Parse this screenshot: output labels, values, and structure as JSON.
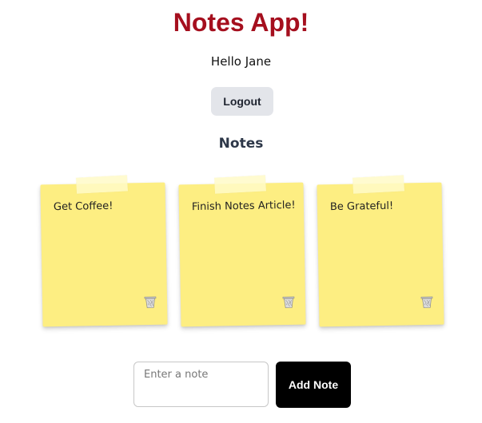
{
  "header": {
    "title": "Notes App!",
    "greeting": "Hello Jane",
    "logout_label": "Logout"
  },
  "notes_section": {
    "heading": "Notes",
    "notes": [
      {
        "text": "Get Coffee!",
        "delete_icon": "trash-icon"
      },
      {
        "text": "Finish Notes Article!",
        "delete_icon": "trash-icon"
      },
      {
        "text": "Be Grateful!",
        "delete_icon": "trash-icon"
      }
    ]
  },
  "composer": {
    "placeholder": "Enter a note",
    "value": "",
    "add_label": "Add Note"
  },
  "colors": {
    "title": "#a50f1e",
    "note_background": "#fdee82",
    "add_button": "#000000",
    "logout_button": "#e3e5ea"
  }
}
